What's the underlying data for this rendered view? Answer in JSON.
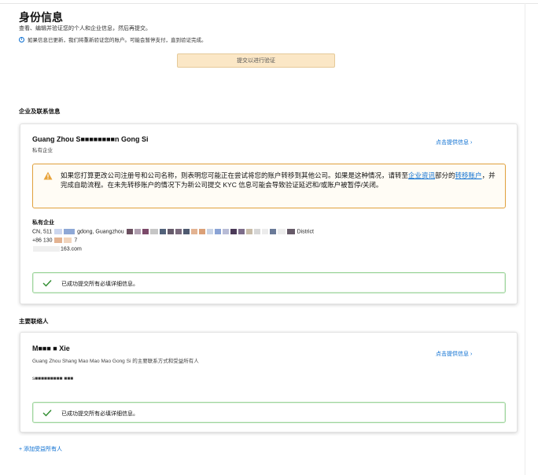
{
  "page": {
    "title": "身份信息",
    "subtitle": "查看、编辑并验证您的个人和企业信息，然后再提交。",
    "notice": "如果信息已更新，我们将重新验证您的账户。可能会暂停支付，直到验证完成。",
    "notice_icon": "info-icon",
    "submit_button": "提交以进行验证"
  },
  "business_section": {
    "title": "企业及联系信息",
    "company_name": "Guang Zhou S■■■■■■■■n Gong Si",
    "company_type": "私有企业",
    "provide_link": "点击提供信息 ›",
    "warning": {
      "icon": "warning-icon",
      "text_1": "如果您打算更改公司注册号和公司名称，则表明您可能正在尝试将您的账户转移到其他公司。如果是这种情况，请转至",
      "link_1": "企业资讯",
      "text_2": "部分的",
      "link_2": "转移账户",
      "text_3": "，并完成自助流程。在未先转移账户的情况下为新公司提交 KYC 信息可能会导致验证延迟和/或账户被暂停/关闭。"
    },
    "address_label": "私有企业",
    "address_prefix": "CN, 511",
    "address_mid": "gdong, Guangzhou",
    "address_suffix": "District",
    "phone_prefix": "+86 130",
    "phone_suffix": "7",
    "email_suffix": "163.com",
    "success_text": "已成功提交所有必填详细信息。",
    "success_icon": "check-icon"
  },
  "contact_section": {
    "title": "主要联络人",
    "contact_name": "M■■■ ■ Xie",
    "description": "Guang Zhou Shang Mao Mao Mao Gong Si 的主要联系方式和受益所有人",
    "provide_link": "点击提供信息 ›",
    "email_masked": "s■■■■■■■■■ ■■■",
    "success_text": "已成功提交所有必填详细信息。",
    "success_icon": "check-icon"
  },
  "add_beneficial_owner": "+ 添加受益所有人",
  "colors": {
    "link": "#0a6ed1",
    "warning_border": "#e0a03b",
    "success_border": "#9ed59d",
    "success_check": "#2e8b2e",
    "button_bg": "#fbe7c6"
  }
}
